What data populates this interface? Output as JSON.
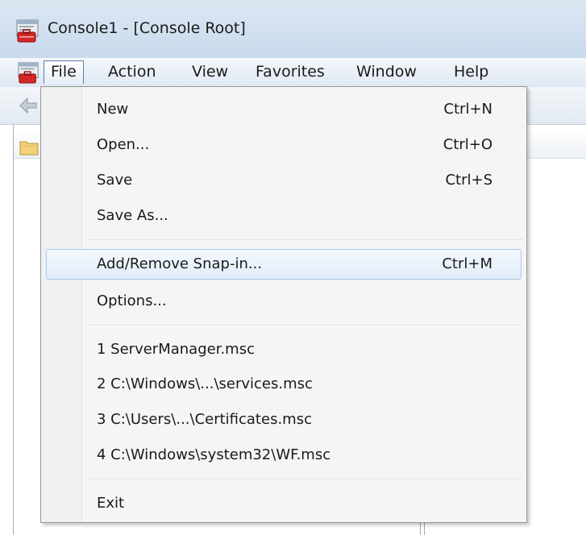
{
  "window": {
    "title": "Console1 - [Console Root]"
  },
  "menubar": {
    "items": [
      {
        "label": "File",
        "active": true
      },
      {
        "label": "Action"
      },
      {
        "label": "View"
      },
      {
        "label": "Favorites"
      },
      {
        "label": "Window"
      },
      {
        "label": "Help"
      }
    ]
  },
  "file_menu": {
    "items": [
      {
        "label": "New",
        "shortcut": "Ctrl+N"
      },
      {
        "label": "Open...",
        "shortcut": "Ctrl+O"
      },
      {
        "label": "Save",
        "shortcut": "Ctrl+S"
      },
      {
        "label": "Save As...",
        "shortcut": ""
      },
      {
        "label": "Add/Remove Snap-in...",
        "shortcut": "Ctrl+M",
        "highlighted": true
      },
      {
        "label": "Options...",
        "shortcut": ""
      },
      {
        "label": "1 ServerManager.msc",
        "shortcut": ""
      },
      {
        "label": "2 C:\\Windows\\...\\services.msc",
        "shortcut": ""
      },
      {
        "label": "3 C:\\Users\\...\\Certificates.msc",
        "shortcut": ""
      },
      {
        "label": "4 C:\\Windows\\system32\\WF.msc",
        "shortcut": ""
      },
      {
        "label": "Exit",
        "shortcut": ""
      }
    ]
  },
  "icons": {
    "app": "mmc-console-icon",
    "back": "back-arrow-icon",
    "tree_root": "folder-icon"
  },
  "colors": {
    "titlebar": "#c9daeb",
    "menu_background": "#f5f5f5",
    "highlight_border": "#a8c8eb"
  }
}
